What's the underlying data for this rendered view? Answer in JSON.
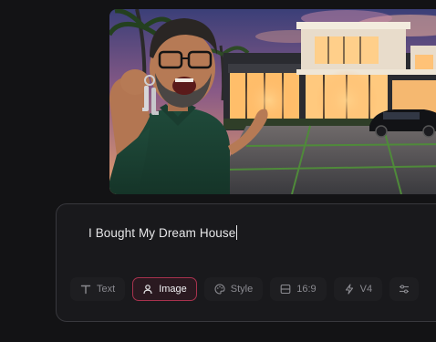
{
  "generated_image": {
    "alt": "Generated image"
  },
  "composer": {
    "prompt_text": "I Bought My Dream House",
    "toolbar": {
      "text_label": "Text",
      "image_label": "Image",
      "style_label": "Style",
      "aspect_label": "16:9",
      "version_label": "V4"
    },
    "icons": {
      "text": "text-icon",
      "image": "person-icon",
      "style": "palette-icon",
      "aspect": "aspect-ratio-icon",
      "version": "lightning-icon",
      "settings": "sliders-icon"
    }
  },
  "colors": {
    "background": "#131315",
    "composer_bg": "#19191c",
    "composer_border": "#38383d",
    "active_border": "#a8324e",
    "muted_text": "#8a8a90",
    "text": "#e6e6e8"
  }
}
